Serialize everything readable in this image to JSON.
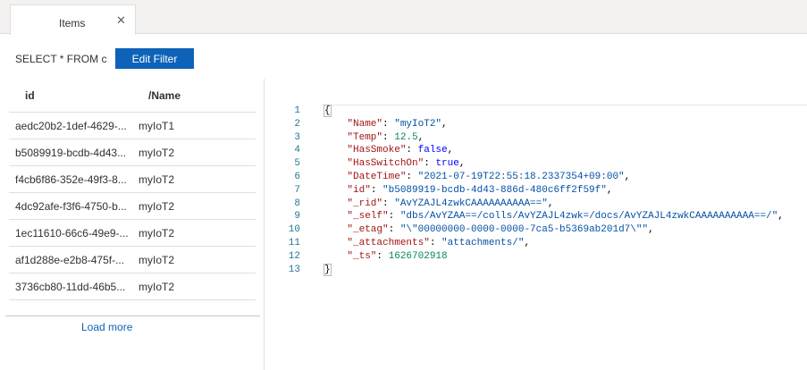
{
  "tab": {
    "title": "Items",
    "close_glyph": "✕"
  },
  "filter": {
    "query_text": "SELECT * FROM c",
    "button_label": "Edit Filter"
  },
  "list": {
    "columns": {
      "id": "id",
      "name": "/Name"
    },
    "rows": [
      {
        "id": "aedc20b2-1def-4629-...",
        "name": "myIoT1"
      },
      {
        "id": "b5089919-bcdb-4d43...",
        "name": "myIoT2"
      },
      {
        "id": "f4cb6f86-352e-49f3-8...",
        "name": "myIoT2"
      },
      {
        "id": "4dc92afe-f3f6-4750-b...",
        "name": "myIoT2"
      },
      {
        "id": "1ec11610-66c6-49e9-...",
        "name": "myIoT2"
      },
      {
        "id": "af1d288e-e2b8-475f-...",
        "name": "myIoT2"
      },
      {
        "id": "3736cb80-11dd-46b5...",
        "name": "myIoT2"
      }
    ],
    "load_more": "Load more"
  },
  "document": {
    "open_brace": "{",
    "close_brace": "}",
    "fields": [
      {
        "key": "\"Name\"",
        "value": "\"myIoT2\"",
        "type": "string"
      },
      {
        "key": "\"Temp\"",
        "value": "12.5",
        "type": "number"
      },
      {
        "key": "\"HasSmoke\"",
        "value": "false",
        "type": "bool"
      },
      {
        "key": "\"HasSwitchOn\"",
        "value": "true",
        "type": "bool"
      },
      {
        "key": "\"DateTime\"",
        "value": "\"2021-07-19T22:55:18.2337354+09:00\"",
        "type": "string"
      },
      {
        "key": "\"id\"",
        "value": "\"b5089919-bcdb-4d43-886d-480c6ff2f59f\"",
        "type": "string"
      },
      {
        "key": "\"_rid\"",
        "value": "\"AvYZAJL4zwkCAAAAAAAAAA==\"",
        "type": "string"
      },
      {
        "key": "\"_self\"",
        "value": "\"dbs/AvYZAA==/colls/AvYZAJL4zwk=/docs/AvYZAJL4zwkCAAAAAAAAAA==/\"",
        "type": "string"
      },
      {
        "key": "\"_etag\"",
        "value": "\"\\\"00000000-0000-0000-7ca5-b5369ab201d7\\\"\"",
        "type": "string"
      },
      {
        "key": "\"_attachments\"",
        "value": "\"attachments/\"",
        "type": "string"
      },
      {
        "key": "\"_ts\"",
        "value": "1626702918",
        "type": "number"
      }
    ],
    "line_numbers": [
      "1",
      "2",
      "3",
      "4",
      "5",
      "6",
      "7",
      "8",
      "9",
      "10",
      "11",
      "12",
      "13"
    ]
  },
  "colors": {
    "accent": "#0e62b8",
    "key": "#a31515",
    "string": "#0451a5",
    "number": "#098658",
    "bool": "#0000ff",
    "line_number": "#237893"
  }
}
